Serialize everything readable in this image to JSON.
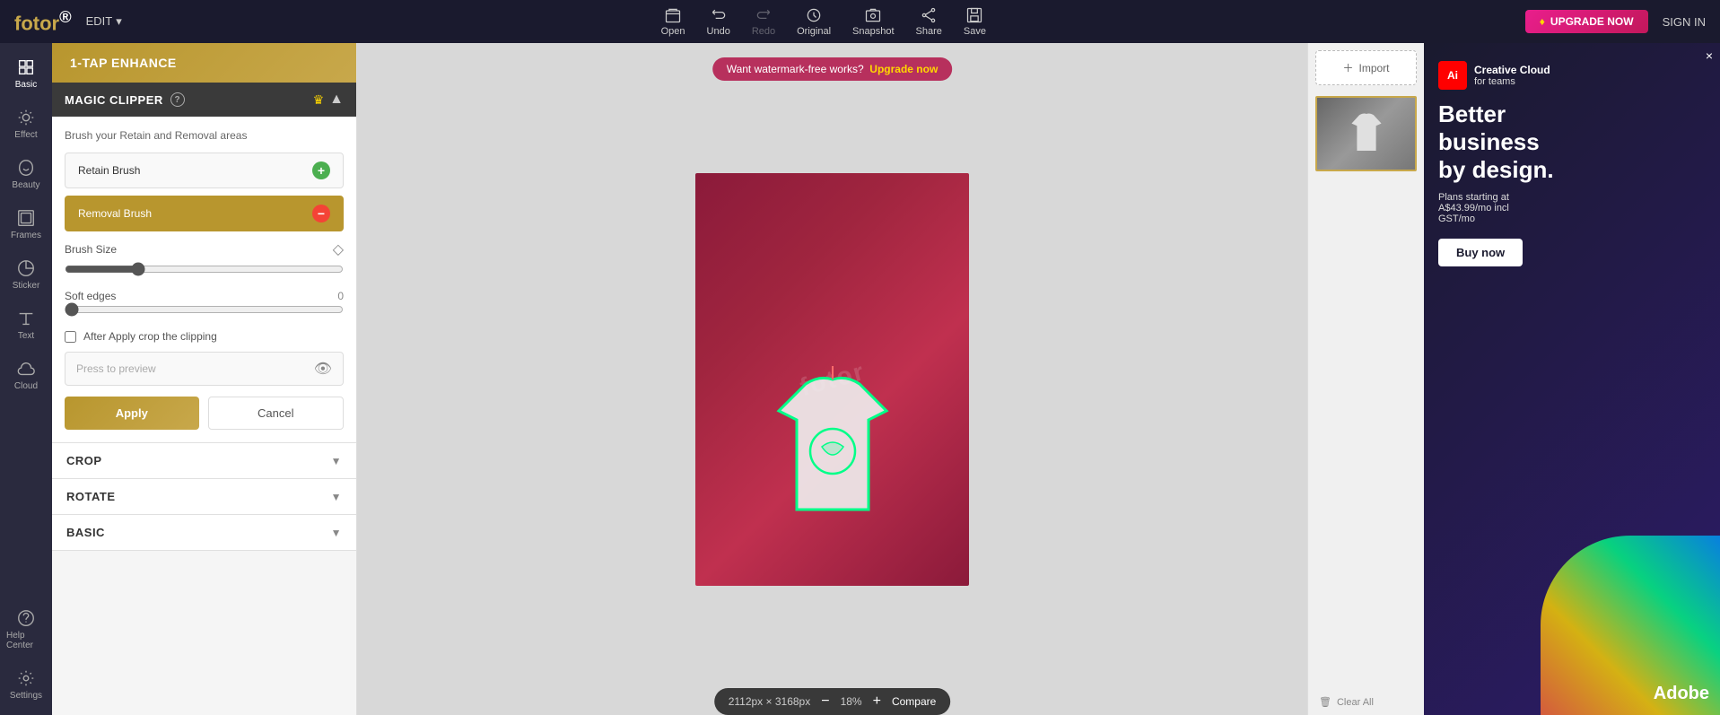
{
  "app": {
    "name": "fotor",
    "logo_suffix": "®"
  },
  "topbar": {
    "edit_label": "EDIT",
    "tools": [
      {
        "id": "open",
        "label": "Open"
      },
      {
        "id": "undo",
        "label": "Undo"
      },
      {
        "id": "redo",
        "label": "Redo"
      },
      {
        "id": "original",
        "label": "Original"
      },
      {
        "id": "snapshot",
        "label": "Snapshot"
      },
      {
        "id": "share",
        "label": "Share"
      },
      {
        "id": "save",
        "label": "Save"
      }
    ],
    "upgrade_label": "UPGRADE NOW",
    "signin_label": "SIGN IN"
  },
  "left_sidebar": {
    "items": [
      {
        "id": "basic",
        "label": "Basic",
        "active": true
      },
      {
        "id": "effect",
        "label": "Effect"
      },
      {
        "id": "beauty",
        "label": "Beauty"
      },
      {
        "id": "frames",
        "label": "Frames"
      },
      {
        "id": "sticker",
        "label": "Sticker"
      },
      {
        "id": "text",
        "label": "Text"
      },
      {
        "id": "cloud",
        "label": "Cloud"
      }
    ],
    "bottom_items": [
      {
        "id": "help-center",
        "label": "Help Center"
      },
      {
        "id": "settings",
        "label": "Settings"
      }
    ]
  },
  "tools_panel": {
    "one_tap_label": "1-TAP ENHANCE",
    "magic_clipper": {
      "title": "MAGIC CLIPPER",
      "subtitle": "Brush your Retain and Removal areas",
      "retain_brush_label": "Retain Brush",
      "removal_brush_label": "Removal Brush",
      "brush_size_label": "Brush Size",
      "soft_edges_label": "Soft edges",
      "soft_edges_value": "0",
      "checkbox_label": "After Apply crop the clipping",
      "preview_placeholder": "Press to preview",
      "apply_label": "Apply",
      "cancel_label": "Cancel"
    },
    "accordion": [
      {
        "id": "crop",
        "label": "CROP"
      },
      {
        "id": "rotate",
        "label": "ROTATE"
      },
      {
        "id": "basic",
        "label": "BASIC"
      }
    ]
  },
  "canvas": {
    "watermark_text": "Want watermark-free works?",
    "watermark_link": "Upgrade now",
    "dimensions": "2112px × 3168px",
    "zoom": "18%",
    "compare_label": "Compare",
    "fotor_watermark": "fotor"
  },
  "right_sidebar": {
    "import_label": "Import",
    "clear_all_label": "Clear All"
  },
  "ad": {
    "brand": "Creative Cloud",
    "brand_subtitle": "for teams",
    "title_line1": "Better",
    "title_line2": "business",
    "title_line3": "by design.",
    "subtitle": "Plans starting at\nA$43.99/mo incl\nGST/mo",
    "buy_label": "Buy now",
    "close_label": "×"
  }
}
